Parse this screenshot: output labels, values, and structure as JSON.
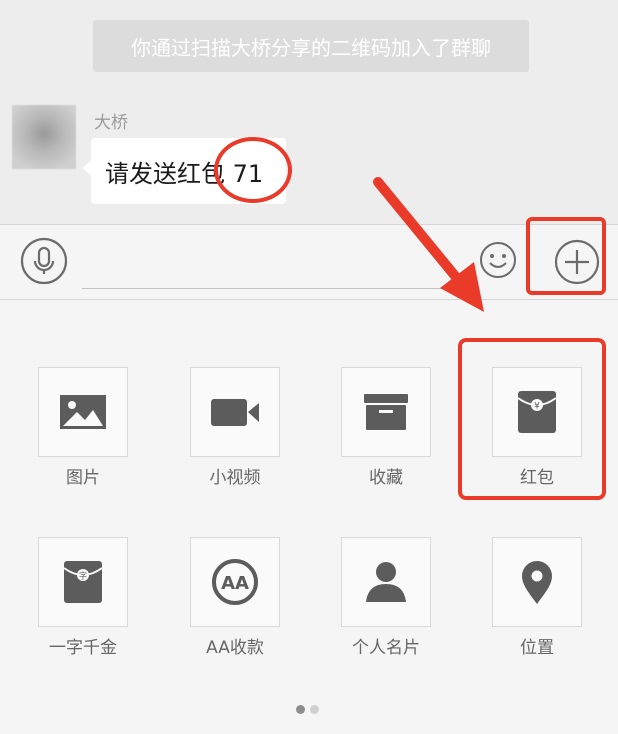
{
  "chat": {
    "system_notice": "你通过扫描大桥分享的二维码加入了群聊",
    "sender_name": "大桥",
    "message_text": "请发送红包 71"
  },
  "input_bar": {
    "text_value": "",
    "icons": {
      "voice": "microphone-icon",
      "emoji": "smiley-icon",
      "more": "plus-circle-icon"
    }
  },
  "panel": {
    "items": [
      {
        "label": "图片",
        "icon": "image-icon"
      },
      {
        "label": "小视频",
        "icon": "video-camera-icon"
      },
      {
        "label": "收藏",
        "icon": "favorites-box-icon"
      },
      {
        "label": "红包",
        "icon": "red-packet-icon"
      },
      {
        "label": "一字千金",
        "icon": "character-red-packet-icon"
      },
      {
        "label": "AA收款",
        "icon": "aa-collection-icon"
      },
      {
        "label": "个人名片",
        "icon": "contact-card-icon"
      },
      {
        "label": "位置",
        "icon": "location-pin-icon"
      }
    ],
    "pager": {
      "pages": 2,
      "current": 1
    }
  },
  "colors": {
    "annotation_red": "#ea3a29",
    "icon_gray": "#5c5c5c",
    "label_gray": "#666666",
    "background": "#ededed"
  }
}
